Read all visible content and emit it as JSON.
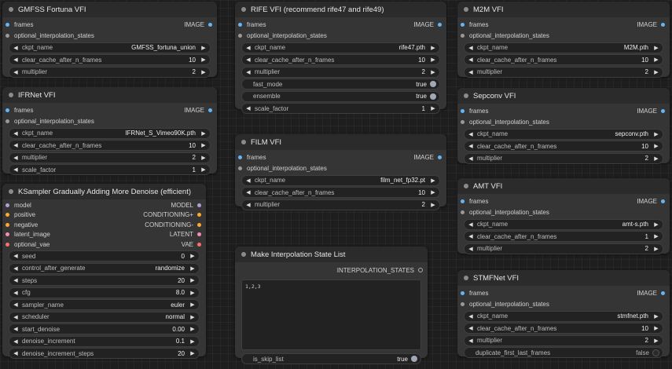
{
  "colors": {
    "canvas": "#1e1e1e",
    "node_body": "#353535",
    "node_title": "#2b2b2b",
    "image_socket": "#64b5f6",
    "model_socket": "#b39ddb",
    "conditioning_socket": "#ffa931",
    "latent_socket": "#f48fb1",
    "vae_socket": "#ff6e6e"
  },
  "gmfss": {
    "title": "GMFSS Fortuna VFI",
    "frames": "frames",
    "output": "IMAGE",
    "states": "optional_interpolation_states",
    "widgets": [
      {
        "label": "ckpt_name",
        "value": "GMFSS_fortuna_union"
      },
      {
        "label": "clear_cache_after_n_frames",
        "value": "10"
      },
      {
        "label": "multiplier",
        "value": "2"
      }
    ]
  },
  "ifrnet": {
    "title": "IFRNet VFI",
    "frames": "frames",
    "output": "IMAGE",
    "states": "optional_interpolation_states",
    "widgets": [
      {
        "label": "ckpt_name",
        "value": "IFRNet_S_Vimeo90K.pth"
      },
      {
        "label": "clear_cache_after_n_frames",
        "value": "10"
      },
      {
        "label": "multiplier",
        "value": "2"
      },
      {
        "label": "scale_factor",
        "value": "1"
      }
    ]
  },
  "ksampler": {
    "title": "KSampler Gradually Adding More Denoise (efficient)",
    "inputs": [
      {
        "label": "model",
        "output": "MODEL"
      },
      {
        "label": "positive",
        "output": "CONDITIONING+"
      },
      {
        "label": "negative",
        "output": "CONDITIONING-"
      },
      {
        "label": "latent_image",
        "output": "LATENT"
      },
      {
        "label": "optional_vae",
        "output": "VAE"
      }
    ],
    "widgets": [
      {
        "label": "seed",
        "value": "0"
      },
      {
        "label": "control_after_generate",
        "value": "randomize"
      },
      {
        "label": "steps",
        "value": "20"
      },
      {
        "label": "cfg",
        "value": "8.0"
      },
      {
        "label": "sampler_name",
        "value": "euler"
      },
      {
        "label": "scheduler",
        "value": "normal"
      },
      {
        "label": "start_denoise",
        "value": "0.00"
      },
      {
        "label": "denoise_increment",
        "value": "0.1"
      },
      {
        "label": "denoise_increment_steps",
        "value": "20"
      }
    ]
  },
  "rife": {
    "title": "RIFE VFI (recommend rife47 and rife49)",
    "frames": "frames",
    "output": "IMAGE",
    "states": "optional_interpolation_states",
    "widgets": [
      {
        "label": "ckpt_name",
        "value": "rife47.pth"
      },
      {
        "label": "clear_cache_after_n_frames",
        "value": "10"
      },
      {
        "label": "multiplier",
        "value": "2"
      }
    ],
    "toggles": [
      {
        "label": "fast_mode",
        "value": "true"
      },
      {
        "label": "ensemble",
        "value": "true"
      }
    ],
    "scale": {
      "label": "scale_factor",
      "value": "1"
    }
  },
  "film": {
    "title": "FILM VFI",
    "frames": "frames",
    "output": "IMAGE",
    "states": "optional_interpolation_states",
    "widgets": [
      {
        "label": "ckpt_name",
        "value": "film_net_fp32.pt"
      },
      {
        "label": "clear_cache_after_n_frames",
        "value": "10"
      },
      {
        "label": "multiplier",
        "value": "2"
      }
    ]
  },
  "makestate": {
    "title": "Make Interpolation State List",
    "output": "INTERPOLATION_STATES",
    "text": "1,2,3",
    "toggle": {
      "label": "is_skip_list",
      "value": "true"
    }
  },
  "m2m": {
    "title": "M2M VFI",
    "frames": "frames",
    "output": "IMAGE",
    "states": "optional_interpolation_states",
    "widgets": [
      {
        "label": "ckpt_name",
        "value": "M2M.pth"
      },
      {
        "label": "clear_cache_after_n_frames",
        "value": "10"
      },
      {
        "label": "multiplier",
        "value": "2"
      }
    ]
  },
  "sepconv": {
    "title": "Sepconv VFI",
    "frames": "frames",
    "output": "IMAGE",
    "states": "optional_interpolation_states",
    "widgets": [
      {
        "label": "ckpt_name",
        "value": "sepconv.pth"
      },
      {
        "label": "clear_cache_after_n_frames",
        "value": "10"
      },
      {
        "label": "multiplier",
        "value": "2"
      }
    ]
  },
  "amt": {
    "title": "AMT VFI",
    "frames": "frames",
    "output": "IMAGE",
    "states": "optional_interpolation_states",
    "widgets": [
      {
        "label": "ckpt_name",
        "value": "amt-s.pth"
      },
      {
        "label": "clear_cache_after_n_frames",
        "value": "1"
      },
      {
        "label": "multiplier",
        "value": "2"
      }
    ]
  },
  "stmf": {
    "title": "STMFNet VFI",
    "frames": "frames",
    "output": "IMAGE",
    "states": "optional_interpolation_states",
    "widgets": [
      {
        "label": "ckpt_name",
        "value": "stmfnet.pth"
      },
      {
        "label": "clear_cache_after_n_frames",
        "value": "10"
      },
      {
        "label": "multiplier",
        "value": "2"
      }
    ],
    "toggle": {
      "label": "duplicate_first_last_frames",
      "value": "false"
    }
  }
}
